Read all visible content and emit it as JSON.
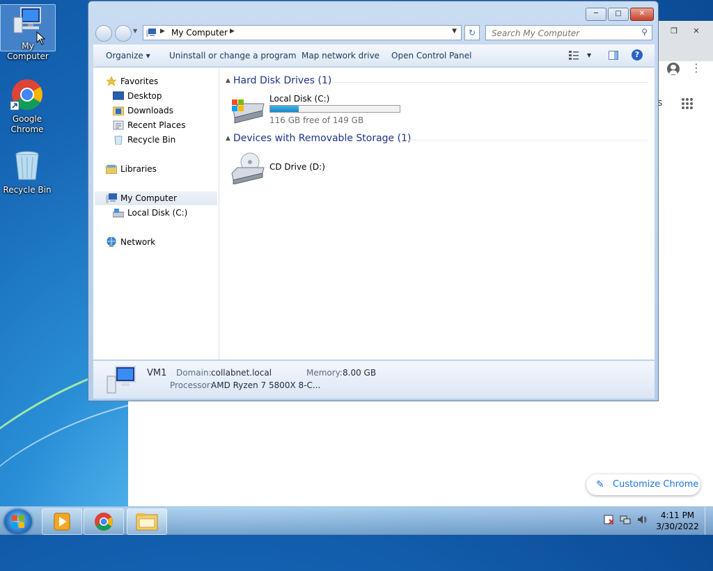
{
  "desktop": {
    "icons": [
      {
        "label": "My Computer"
      },
      {
        "label": "Google Chrome"
      },
      {
        "label": "Recycle Bin"
      }
    ]
  },
  "explorer": {
    "address": {
      "crumb": "My Computer"
    },
    "search": {
      "placeholder": "Search My Computer"
    },
    "toolbar": {
      "organize": "Organize",
      "uninstall": "Uninstall or change a program",
      "map_drive": "Map network drive",
      "control_panel": "Open Control Panel",
      "help": "?"
    },
    "nav": {
      "favorites": "Favorites",
      "desktop": "Desktop",
      "downloads": "Downloads",
      "recent": "Recent Places",
      "recycle": "Recycle Bin",
      "libraries": "Libraries",
      "my_computer": "My Computer",
      "local_disk": "Local Disk (C:)",
      "network": "Network"
    },
    "groups": {
      "hdd": "Hard Disk Drives (1)",
      "removable": "Devices with Removable Storage (1)"
    },
    "drives": {
      "c_name": "Local Disk (C:)",
      "c_free": "116 GB free of 149 GB",
      "c_used_fraction": 0.22,
      "d_name": "CD Drive (D:)"
    },
    "details": {
      "name": "VM1",
      "domain_label": "Domain:",
      "domain_value": "collabnet.local",
      "memory_label": "Memory:",
      "memory_value": "8.00 GB",
      "processor_label": "Processor:",
      "processor_value": "AMD Ryzen 7 5800X 8-C..."
    }
  },
  "chrome": {
    "partial_text": "s",
    "customize": "Customize Chrome"
  },
  "taskbar": {
    "time": "4:11 PM",
    "date": "3/30/2022"
  },
  "colors": {
    "accent": "#1a73e8",
    "group_heading": "#1e3287",
    "disk_bar": "#26a0da"
  }
}
